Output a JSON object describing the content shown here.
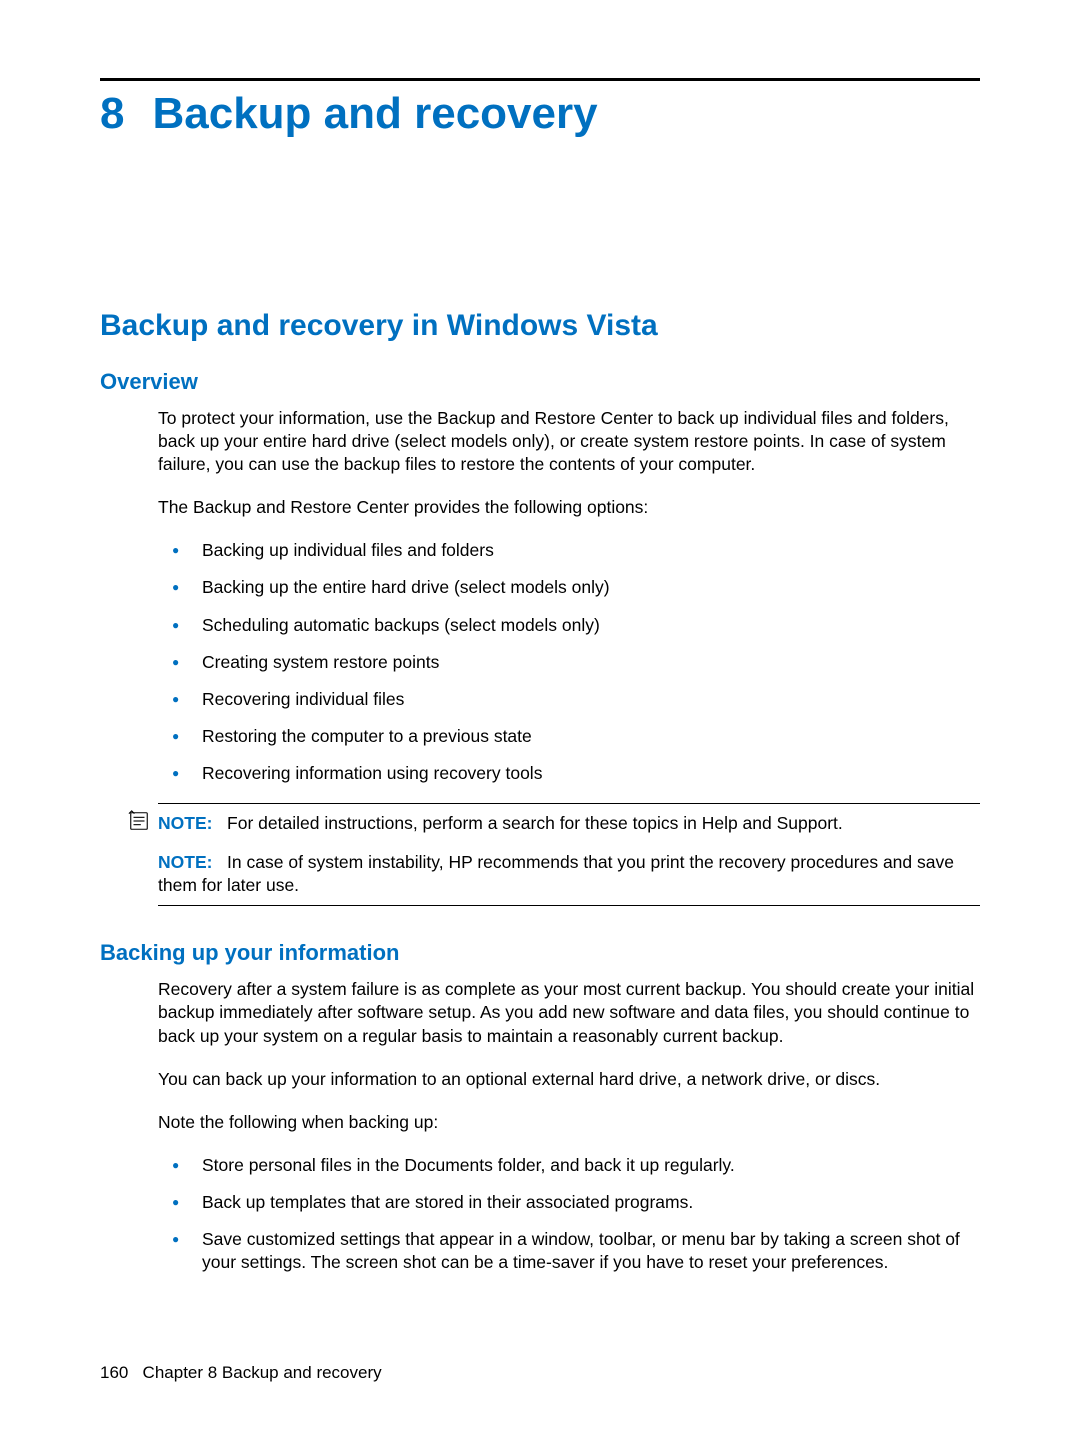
{
  "chapter": {
    "number": "8",
    "title": "Backup and recovery"
  },
  "section": {
    "title": "Backup and recovery in Windows Vista"
  },
  "overview": {
    "heading": "Overview",
    "para1": "To protect your information, use the Backup and Restore Center to back up individual files and folders, back up your entire hard drive (select models only), or create system restore points. In case of system failure, you can use the backup files to restore the contents of your computer.",
    "para2": "The Backup and Restore Center provides the following options:",
    "bullets": [
      "Backing up individual files and folders",
      "Backing up the entire hard drive (select models only)",
      "Scheduling automatic backups (select models only)",
      "Creating system restore points",
      "Recovering individual files",
      "Restoring the computer to a previous state",
      "Recovering information using recovery tools"
    ],
    "note1_label": "NOTE:",
    "note1_text": "For detailed instructions, perform a search for these topics in Help and Support.",
    "note2_label": "NOTE:",
    "note2_text": "In case of system instability, HP recommends that you print the recovery procedures and save them for later use."
  },
  "backing_up": {
    "heading": "Backing up your information",
    "para1": "Recovery after a system failure is as complete as your most current backup. You should create your initial backup immediately after software setup. As you add new software and data files, you should continue to back up your system on a regular basis to maintain a reasonably current backup.",
    "para2": "You can back up your information to an optional external hard drive, a network drive, or discs.",
    "para3": "Note the following when backing up:",
    "bullets": [
      "Store personal files in the Documents folder, and back it up regularly.",
      "Back up templates that are stored in their associated programs.",
      "Save customized settings that appear in a window, toolbar, or menu bar by taking a screen shot of your settings. The screen shot can be a time-saver if you have to reset your preferences."
    ]
  },
  "footer": {
    "page_number": "160",
    "chapter_ref": "Chapter 8   Backup and recovery"
  }
}
